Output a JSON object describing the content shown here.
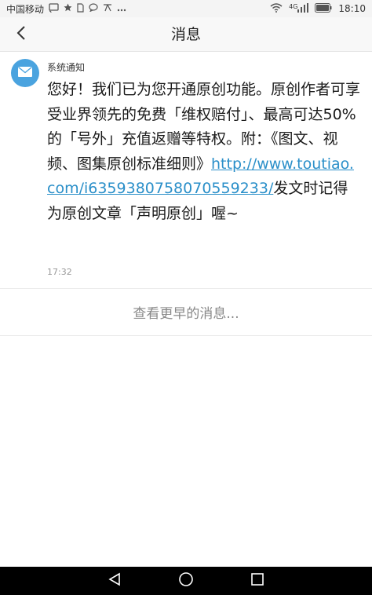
{
  "status_bar": {
    "carrier": "中国移动",
    "network": "4G",
    "time": "18:10",
    "icons": [
      "cast-icon",
      "star-icon",
      "sim-icon",
      "message-icon",
      "text-icon",
      "more-icon",
      "wifi-icon",
      "signal-icon",
      "battery-icon"
    ]
  },
  "header": {
    "title": "消息"
  },
  "message": {
    "sender": "系统通知",
    "text_before_link": "您好！我们已为您开通原创功能。原创作者可享受业界领先的免费「维权赔付」、最高可达50%的「号外」充值返赠等特权。附：《图文、视频、图集原创标准细则》",
    "link": "http://www.toutiao.com/i6359380758070559233/",
    "text_after_link": "发文时记得为原创文章「声明原创」喔~",
    "time": "17:32"
  },
  "earlier_button": {
    "label": "查看更早的消息..."
  },
  "colors": {
    "link": "#2a8fc9",
    "avatar": "#4aa3df",
    "nav_bar": "#000000"
  }
}
